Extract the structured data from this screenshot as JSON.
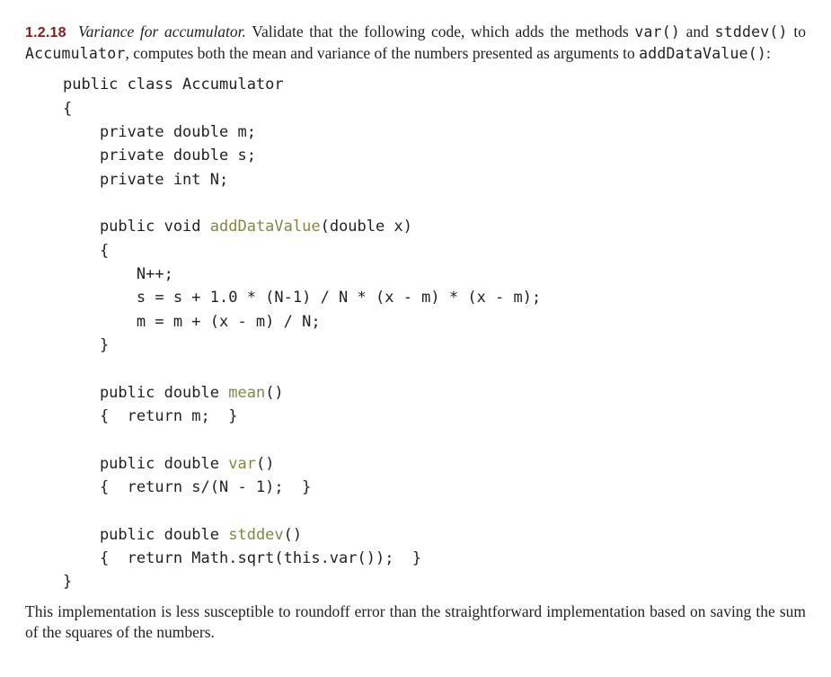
{
  "exercise": {
    "number": "1.2.18",
    "title": "Variance for accumulator.",
    "intro_1": " Validate that the following code, which adds the methods ",
    "m1": "var()",
    "intro_2": " and ",
    "m2": "stddev()",
    "intro_3": " to ",
    "cls": "Accumulator",
    "intro_4": ", computes both the mean and variance of the numbers presented as arguments to ",
    "m3": "addDataValue()",
    "intro_5": ":"
  },
  "code": {
    "l01": "public class Accumulator",
    "l02": "{",
    "l03": "    private double m;",
    "l04": "    private double s;",
    "l05": "    private int N;",
    "l06a": "    public void ",
    "l06b": "addDataValue",
    "l06c": "(double x)",
    "l07": "    {",
    "l08": "        N++;",
    "l09": "        s = s + 1.0 * (N-1) / N * (x - m) * (x - m);",
    "l10": "        m = m + (x - m) / N;",
    "l11": "    }",
    "l12a": "    public double ",
    "l12b": "mean",
    "l12c": "()",
    "l13": "    {  return m;  }",
    "l14a": "    public double ",
    "l14b": "var",
    "l14c": "()",
    "l15": "    {  return s/(N - 1);  }",
    "l16a": "    public double ",
    "l16b": "stddev",
    "l16c": "()",
    "l17": "    {  return Math.sqrt(this.var());  }",
    "l18": "}"
  },
  "closing": "This implementation is less susceptible to roundoff error than the straightforward implementation based on saving the sum of the squares of the numbers."
}
